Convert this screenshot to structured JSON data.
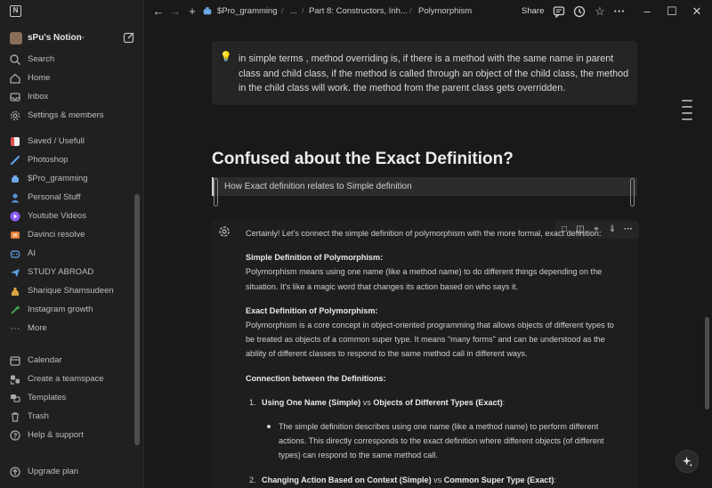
{
  "sidebar": {
    "workspace_name": "sPu's Notion",
    "nav_top": [
      {
        "label": "Search",
        "icon": "search-icon"
      },
      {
        "label": "Home",
        "icon": "home-icon"
      },
      {
        "label": "Inbox",
        "icon": "inbox-icon"
      },
      {
        "label": "Settings & members",
        "icon": "gear-icon"
      }
    ],
    "pages": [
      {
        "label": "Saved / Usefull",
        "icon": "bookmark-icon",
        "color": "#e04d4d"
      },
      {
        "label": "Photoshop",
        "icon": "brush-icon",
        "color": "#5aa0e6"
      },
      {
        "label": "$Pro_gramming",
        "icon": "robot-icon",
        "color": "#6aa8e8"
      },
      {
        "label": "Personal Stuff",
        "icon": "person-icon",
        "color": "#5a8fd6"
      },
      {
        "label": "Youtube Videos",
        "icon": "play-icon",
        "color": "#8b5cf6"
      },
      {
        "label": "Davinci resolve",
        "icon": "film-icon",
        "color": "#e07b39"
      },
      {
        "label": "AI",
        "icon": "bot-icon",
        "color": "#5a8fd6"
      },
      {
        "label": "STUDY ABROAD",
        "icon": "plane-icon",
        "color": "#5aa0e6"
      },
      {
        "label": "Sharique Shamsudeen",
        "icon": "money-bag-icon",
        "color": "#d9a441"
      },
      {
        "label": "Instagram growth",
        "icon": "sparkle-icon",
        "color": "#4caf50"
      },
      {
        "label": "More",
        "icon": "more-icon",
        "color": "#a8a8a8"
      }
    ],
    "nav_bottom": [
      {
        "label": "Calendar",
        "icon": "calendar-icon"
      },
      {
        "label": "Create a teamspace",
        "icon": "teamspace-icon"
      },
      {
        "label": "Templates",
        "icon": "templates-icon"
      },
      {
        "label": "Trash",
        "icon": "trash-icon"
      },
      {
        "label": "Help & support",
        "icon": "help-icon"
      }
    ],
    "upgrade_label": "Upgrade plan"
  },
  "topbar": {
    "breadcrumbs": [
      "$Pro_gramming",
      "...",
      "Part 8: Constructors, Inh...",
      "Polymorphism"
    ],
    "share_label": "Share"
  },
  "page": {
    "callout_icon": "💡",
    "callout_text": "in simple terms , method overriding is, if there is a method with the same name in parent class and child class, if the method is called through an object of the child class, the method in the child class will work. the method from the parent class gets overridden.",
    "heading": "Confused about the Exact Definition?",
    "quote": "How Exact definition relates to Simple definition",
    "chat": {
      "intro": "Certainly! Let's connect the simple definition of polymorphism with the more formal, exact definition:",
      "simple_title": "Simple Definition of Polymorphism:",
      "simple_text": "Polymorphism means using one name (like a method name) to do different things depending on the situation. It's like a magic word that changes its action based on who says it.",
      "exact_title": "Exact Definition of Polymorphism:",
      "exact_text": "Polymorphism is a core concept in object-oriented programming that allows objects of different types to be treated as objects of a common super type. It means \"many forms\" and can be understood as the ability of different classes to respond to the same method call in different ways.",
      "connection_title": "Connection between the Definitions:",
      "item1_num": "1.",
      "item1_a": "Using One Name (Simple)",
      "item1_vs": " vs ",
      "item1_b": "Objects of Different Types (Exact)",
      "item1_colon": ":",
      "item1_bullet": "The simple definition describes using one name (like a method name) to perform different actions. This directly corresponds to the exact definition where different objects (of different types) can respond to the same method call.",
      "item2_num": "2.",
      "item2_a": "Changing Action Based on Context (Simple)",
      "item2_vs": " vs ",
      "item2_b": "Common Super Type (Exact)",
      "item2_colon": ":"
    }
  }
}
